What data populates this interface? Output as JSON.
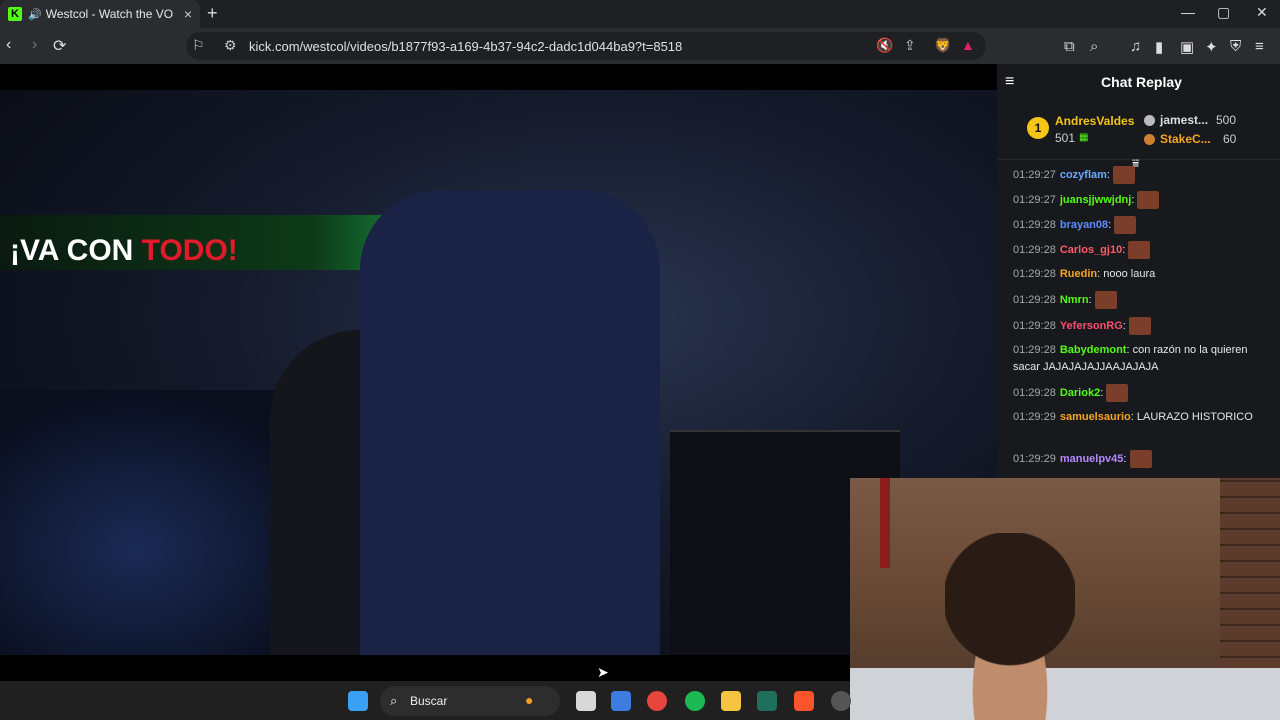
{
  "browser": {
    "tab_title": "Westcol - Watch the VOD on",
    "favicon_letter": "K",
    "new_tab": "+",
    "minimize": "—",
    "maximize": "▢",
    "close": "✕",
    "url": "kick.com/westcol/videos/b1877f93-a169-4b37-94c2-dadc1d044ba9?t=8518"
  },
  "video": {
    "led_text_white": "¡VA CON ",
    "led_text_red": "TODO!"
  },
  "chat": {
    "title": "Chat Replay",
    "leaders": {
      "first": {
        "rank": "1",
        "name": "AndresValdes",
        "count": "501"
      },
      "second": {
        "name": "jamest...",
        "count": "500"
      },
      "third": {
        "name": "StakeC...",
        "count": "60"
      }
    },
    "messages": [
      {
        "ts": "01:29:27",
        "user": "cozyflam",
        "color": "#6aa9ff",
        "text": "",
        "emote": true
      },
      {
        "ts": "01:29:27",
        "user": "juansjjwwjdnj",
        "color": "#53fc18",
        "text": "",
        "emote": true
      },
      {
        "ts": "01:29:28",
        "user": "brayan08",
        "color": "#5b8cff",
        "text": "",
        "emote": true
      },
      {
        "ts": "01:29:28",
        "user": "Carlos_gj10",
        "color": "#ff5a6a",
        "text": "",
        "emote": true
      },
      {
        "ts": "01:29:28",
        "user": "Ruedin",
        "color": "#f5a623",
        "text": "nooo laura",
        "emote": false
      },
      {
        "ts": "01:29:28",
        "user": "Nmrn",
        "color": "#53fc18",
        "text": "",
        "emote": true
      },
      {
        "ts": "01:29:28",
        "user": "YefersonRG",
        "color": "#ff4d6d",
        "text": "",
        "emote": true
      },
      {
        "ts": "01:29:28",
        "user": "Babydemont",
        "color": "#53fc18",
        "text": "con razón no la quieren sacar JAJAJAJAJJAAJAJAJA",
        "emote": false
      },
      {
        "ts": "01:29:28",
        "user": "Dariok2",
        "color": "#53fc18",
        "text": "",
        "emote": true
      },
      {
        "ts": "01:29:29",
        "user": "samuelsaurio",
        "color": "#f5a623",
        "text": "LAURAZO HISTORICO",
        "emote": false
      },
      {
        "ts": "01:29:29",
        "user": "manuelpv45",
        "color": "#b388ff",
        "text": "",
        "emote": true
      }
    ]
  },
  "taskbar": {
    "search_label": "Buscar"
  }
}
